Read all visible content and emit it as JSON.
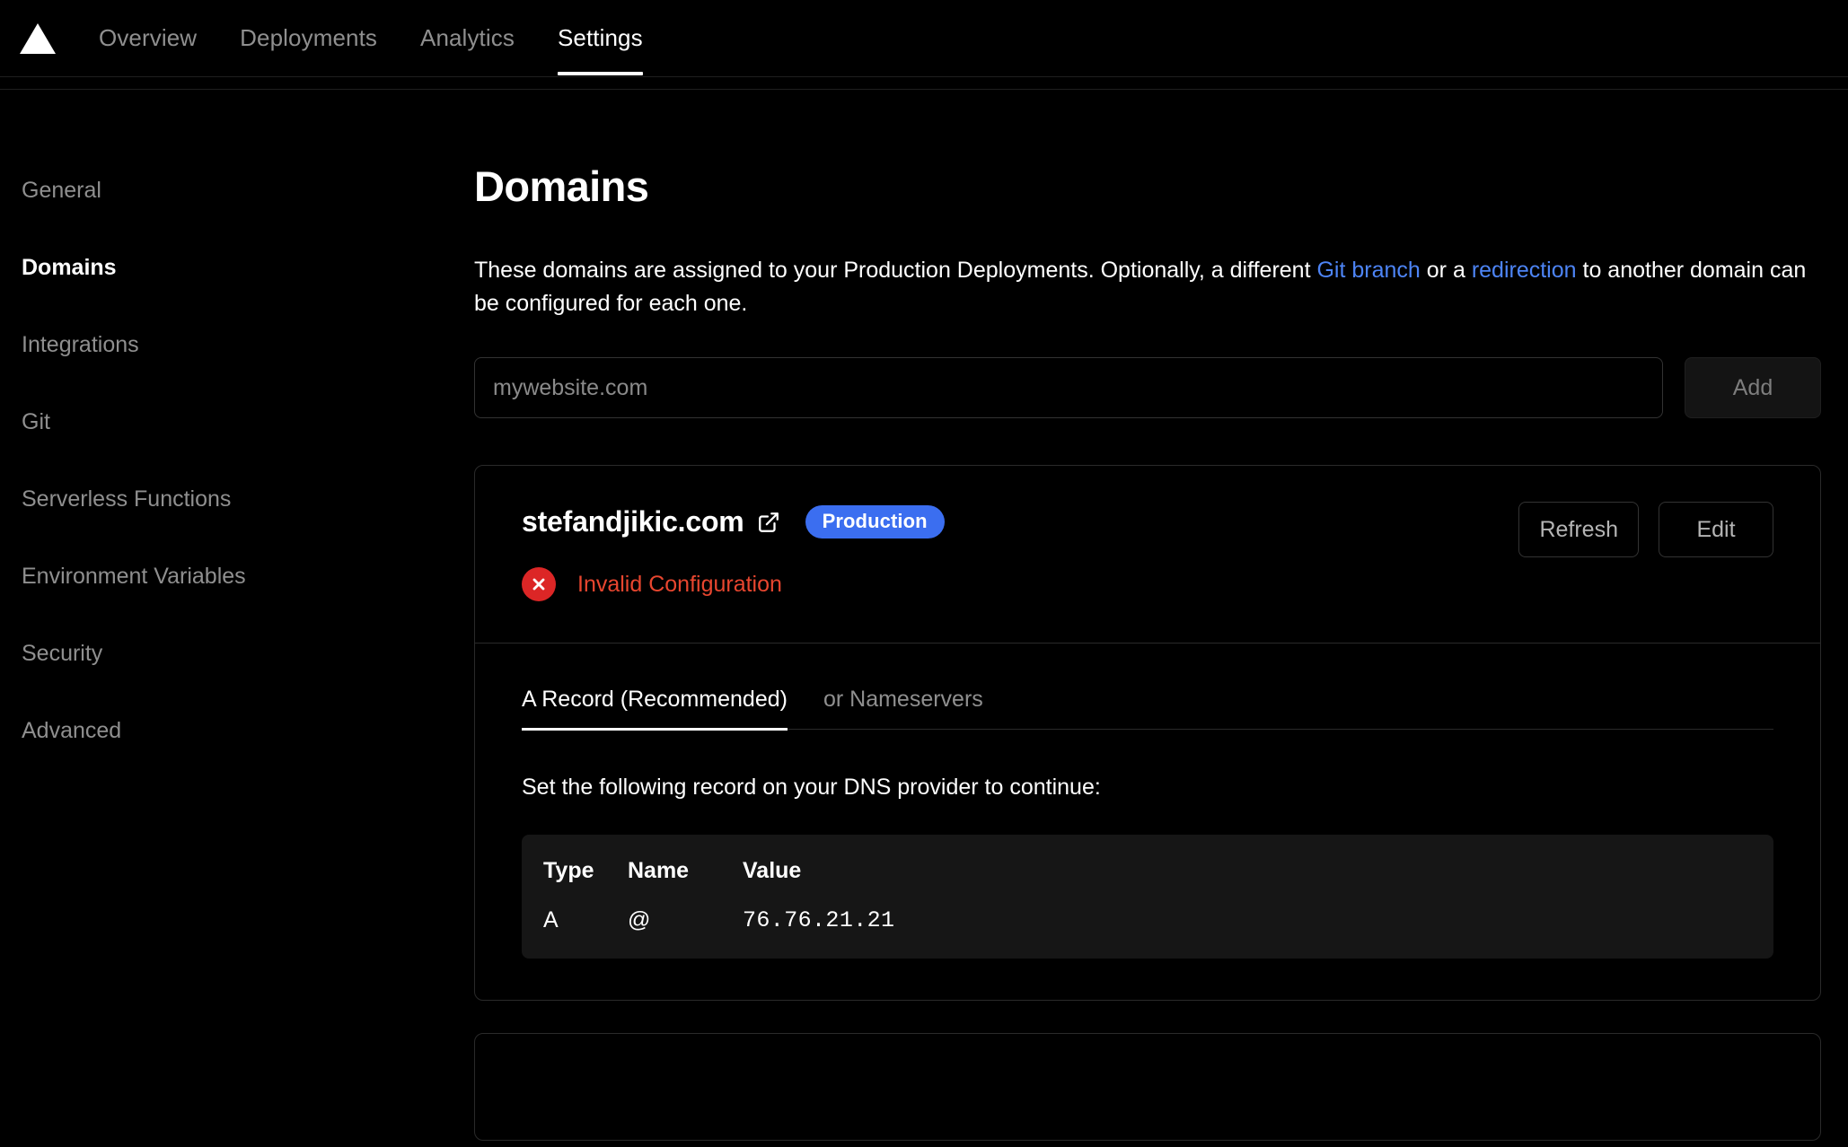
{
  "header": {
    "logo_icon": "vercel-triangle-icon",
    "nav": [
      {
        "label": "Overview",
        "active": false
      },
      {
        "label": "Deployments",
        "active": false
      },
      {
        "label": "Analytics",
        "active": false
      },
      {
        "label": "Settings",
        "active": true
      }
    ]
  },
  "sidebar": {
    "items": [
      {
        "label": "General",
        "active": false
      },
      {
        "label": "Domains",
        "active": true
      },
      {
        "label": "Integrations",
        "active": false
      },
      {
        "label": "Git",
        "active": false
      },
      {
        "label": "Serverless Functions",
        "active": false
      },
      {
        "label": "Environment Variables",
        "active": false
      },
      {
        "label": "Security",
        "active": false
      },
      {
        "label": "Advanced",
        "active": false
      }
    ]
  },
  "main": {
    "title": "Domains",
    "description": {
      "part1": "These domains are assigned to your Production Deployments. Optionally, a different ",
      "link1": "Git branch",
      "part2": " or a ",
      "link2": "redirection",
      "part3": " to another domain can be configured for each one."
    },
    "add_domain": {
      "input_value": "",
      "input_placeholder": "mywebsite.com",
      "button_label": "Add"
    },
    "domain_card": {
      "domain": "stefandjikic.com",
      "external_link_icon": "external-link-icon",
      "badge": "Production",
      "refresh_label": "Refresh",
      "edit_label": "Edit",
      "status_icon": "error-circle-x-icon",
      "status_text": "Invalid Configuration",
      "tabs": [
        {
          "label": "A Record (Recommended)",
          "active": true
        },
        {
          "label": "or Nameservers",
          "active": false
        }
      ],
      "instruction": "Set the following record on your DNS provider to continue:",
      "dns_table": {
        "columns": [
          "Type",
          "Name",
          "Value"
        ],
        "rows": [
          {
            "type": "A",
            "name": "@",
            "value": "76.76.21.21"
          }
        ]
      }
    }
  },
  "colors": {
    "background": "#000000",
    "badge_blue": "#3b6ef0",
    "link_blue": "#4d84f5",
    "error_red": "#e8462f",
    "error_icon_red": "#dc2626",
    "muted_text": "#8f8f8f",
    "border": "#2a2a2a",
    "table_bg": "#161616"
  }
}
